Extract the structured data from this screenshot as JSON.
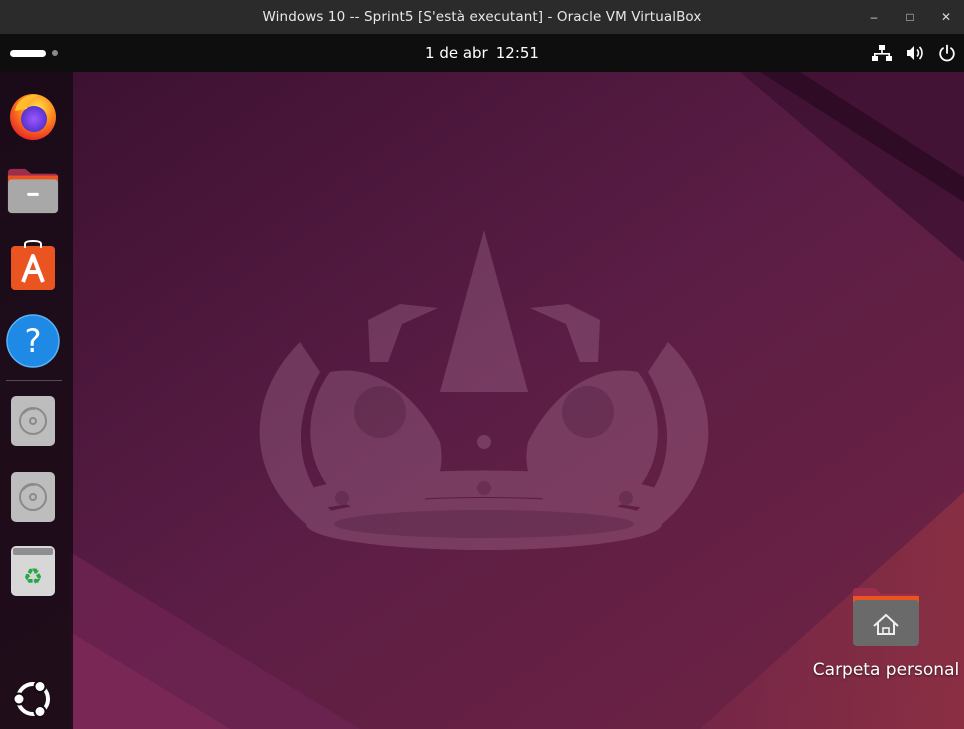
{
  "window": {
    "title": "Windows 10 -- Sprint5 [S'està executant] - Oracle VM VirtualBox",
    "controls": {
      "minimize": "–",
      "maximize": "□",
      "close": "✕"
    }
  },
  "panel": {
    "date": "1 de abr",
    "time": "12:51",
    "tray_icons": [
      "network-icon",
      "volume-icon",
      "power-icon"
    ]
  },
  "dock": {
    "apps": [
      {
        "name": "Firefox",
        "icon": "firefox-icon"
      },
      {
        "name": "Files",
        "icon": "files-icon"
      },
      {
        "name": "App Center",
        "icon": "app-center-icon"
      },
      {
        "name": "Help",
        "icon": "help-icon"
      },
      {
        "name": "Disc",
        "icon": "disc-icon"
      },
      {
        "name": "Disc",
        "icon": "disc-icon"
      },
      {
        "name": "Trash",
        "icon": "trash-icon"
      },
      {
        "name": "Show Apps",
        "icon": "ubuntu-logo-icon"
      }
    ]
  },
  "desktop": {
    "icons": [
      {
        "label": "Carpeta personal",
        "icon": "home-folder-icon"
      }
    ]
  },
  "colors": {
    "desktop_bg": "#5a1d44",
    "panel_bg": "#0e0e0e",
    "titlebar_bg": "#2b2b2b",
    "accent_orange": "#e95420"
  }
}
